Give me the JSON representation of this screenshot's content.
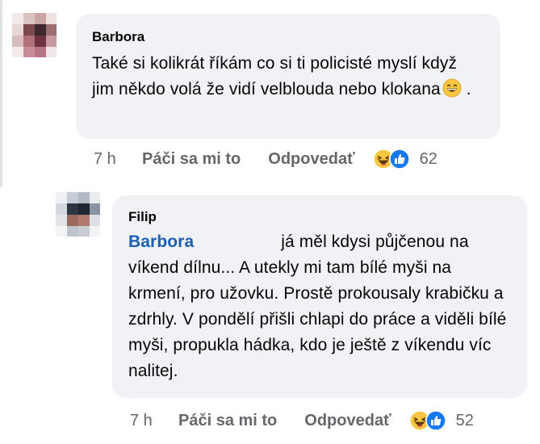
{
  "comments": [
    {
      "author": "Barbora",
      "text": "Také si kolikrát říkám co si ti policisté myslí když jim někdo volá že vidí velblouda nebo klokana",
      "time": "7 h",
      "like_label": "Páči sa mi to",
      "reply_label": "Odpovedať",
      "reaction_icons": [
        "haha-icon",
        "like-icon"
      ],
      "reaction_count": "62"
    },
    {
      "author": "Filip",
      "mention": "Barbora",
      "text": "já měl kdysi půjčenou na víkend dílnu... A utekly mi tam bílé myši na krmení, pro užovku. Prostě prokousaly krabičku a zdrhly. V pondělí přišli chlapi do práce a viděli bílé myši, propukla hádka, kdo je ještě z víkendu víc nalitej.",
      "time": "7 h",
      "like_label": "Páči sa mi to",
      "reply_label": "Odpovedať",
      "reaction_icons": [
        "haha-icon",
        "like-icon"
      ],
      "reaction_count": "52"
    }
  ],
  "colors": {
    "bubble": "#f0f2f5",
    "text": "#050505",
    "secondary": "#65676b",
    "mention": "#1a5fb4",
    "like_blue": "#1877f2",
    "haha_yellow": "#f7c741"
  }
}
